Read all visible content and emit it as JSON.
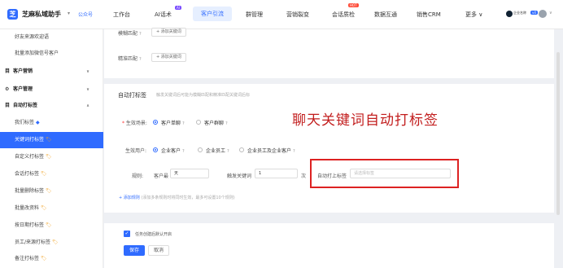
{
  "brand": {
    "title": "芝麻私域助手",
    "caret": "▾",
    "account_tag": "公众号"
  },
  "nav": {
    "items": [
      "工作台",
      "AI话术",
      "客户引流",
      "群管理",
      "营销裂变",
      "会话质检",
      "数据互通",
      "销售CRM",
      "更多 ∨"
    ],
    "ai_badge": "AI",
    "hot_badge": "HOT"
  },
  "user": {
    "name": "企业名称",
    "badge": "v4",
    "caret": "∨"
  },
  "sidebar": {
    "items": [
      {
        "label": "好友来源欢迎语",
        "type": "sub"
      },
      {
        "label": "批量添加微信号客户",
        "type": "sub"
      },
      {
        "label": "客户营销",
        "type": "section",
        "icon": "目",
        "caret": "∨"
      },
      {
        "label": "客户管理",
        "type": "section",
        "icon": "⚙",
        "caret": "∨"
      },
      {
        "label": "自动打标签",
        "type": "section",
        "icon": "目",
        "caret": "∧"
      },
      {
        "label": "我们标签",
        "type": "sub",
        "mark": "◆"
      },
      {
        "label": "关键词打标签",
        "type": "active",
        "mark": "🏷"
      },
      {
        "label": "自定义打标签",
        "type": "sub",
        "mark": "🏷"
      },
      {
        "label": "会话打标签",
        "type": "sub",
        "mark": "🏷"
      },
      {
        "label": "批量删除标签",
        "type": "sub",
        "mark": "🏷"
      },
      {
        "label": "批量改资料",
        "type": "sub",
        "mark": "🏷"
      },
      {
        "label": "按日期打标签",
        "type": "sub",
        "mark": "🏷"
      },
      {
        "label": "员工/来源打标签",
        "type": "sub",
        "mark": "🏷"
      },
      {
        "label": "备注打标签",
        "type": "sub",
        "mark": "🏷"
      }
    ]
  },
  "top_card": {
    "fuzzy_label": "模糊匹配",
    "exact_label": "精准匹配",
    "add_keyword": "+ 添加关键词"
  },
  "auto_tag": {
    "title": "自动打标签",
    "desc": "触发关键词后可能为模糊匹配和精准匹配关键词后标",
    "annotation": "聊天关键词自动打标签",
    "scene_label": "生效场景:",
    "scene_options": [
      "客户单聊",
      "客户群聊"
    ],
    "scope_label": "生效用户:",
    "scope_options": [
      "企业客户",
      "企业员工",
      "企业员工及企业客户"
    ],
    "rule_label": "规则:",
    "customer_label": "客户最",
    "customer_select": "天",
    "trigger_label": "触发关键词",
    "trigger_value": "1",
    "times_unit": "次",
    "auto_tag_label": "自动打上标签",
    "auto_tag_placeholder": "请选择标签",
    "add_rule": "+ 添加规则",
    "add_rule_hint": "(添加多条规则时将同时生效，最多可设置10个规则)"
  },
  "footer": {
    "checkbox_label": "任务创建后默认开启",
    "save": "保存",
    "cancel": "取消"
  }
}
